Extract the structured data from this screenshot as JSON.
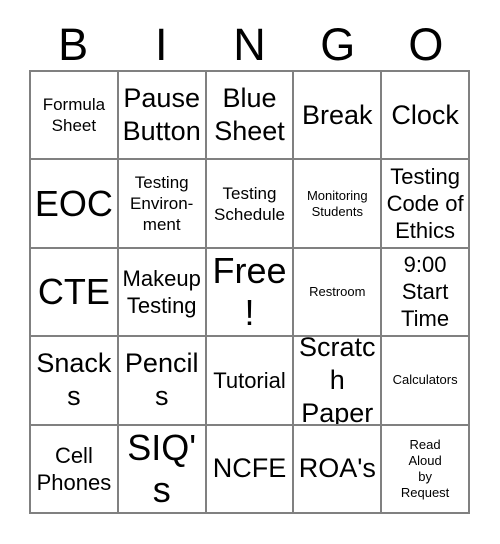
{
  "card": {
    "header_letters": [
      "B",
      "I",
      "N",
      "G",
      "O"
    ],
    "grid_size": "5x5",
    "border_color": "#808080",
    "text_color": "#000000",
    "background_color": "#ffffff",
    "cells": [
      [
        {
          "text": "Formula\nSheet",
          "size": "sm",
          "free_space": false
        },
        {
          "text": "Pause\nButton",
          "size": "lg",
          "free_space": false
        },
        {
          "text": "Blue\nSheet",
          "size": "lg",
          "free_space": false
        },
        {
          "text": "Break",
          "size": "lg",
          "free_space": false
        },
        {
          "text": "Clock",
          "size": "lg",
          "free_space": false
        }
      ],
      [
        {
          "text": "EOC",
          "size": "xl",
          "free_space": false
        },
        {
          "text": "Testing\nEnviron-\nment",
          "size": "sm",
          "free_space": false
        },
        {
          "text": "Testing\nSchedule",
          "size": "sm",
          "free_space": false
        },
        {
          "text": "Monitoring\nStudents",
          "size": "xs",
          "free_space": false
        },
        {
          "text": "Testing\nCode of\nEthics",
          "size": "md",
          "free_space": false
        }
      ],
      [
        {
          "text": "CTE",
          "size": "xl",
          "free_space": false
        },
        {
          "text": "Makeup\nTesting",
          "size": "md",
          "free_space": false
        },
        {
          "text": "Free!",
          "size": "xl",
          "free_space": true
        },
        {
          "text": "Restroom",
          "size": "xs",
          "free_space": false
        },
        {
          "text": "9:00\nStart\nTime",
          "size": "md",
          "free_space": false
        }
      ],
      [
        {
          "text": "Snacks",
          "size": "lg",
          "free_space": false
        },
        {
          "text": "Pencils",
          "size": "lg",
          "free_space": false
        },
        {
          "text": "Tutorial",
          "size": "md",
          "free_space": false
        },
        {
          "text": "Scratch\nPaper",
          "size": "lg",
          "free_space": false
        },
        {
          "text": "Calculators",
          "size": "xs",
          "free_space": false
        }
      ],
      [
        {
          "text": "Cell\nPhones",
          "size": "md",
          "free_space": false
        },
        {
          "text": "SIQ's",
          "size": "xl",
          "free_space": false
        },
        {
          "text": "NCFE",
          "size": "lg",
          "free_space": false
        },
        {
          "text": "ROA's",
          "size": "lg",
          "free_space": false
        },
        {
          "text": "Read\nAloud\nby\nRequest",
          "size": "xs",
          "free_space": false
        }
      ]
    ]
  }
}
